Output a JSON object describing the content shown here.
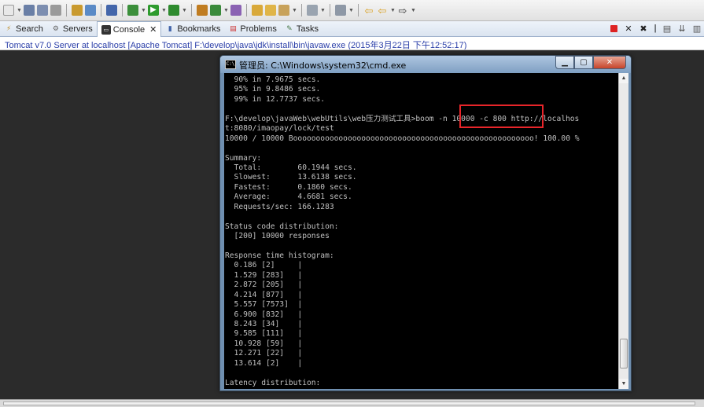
{
  "toolbar": {
    "icons": [
      "new-icon",
      "save-icon",
      "save-all-icon",
      "print-icon",
      "build-icon",
      "debug-skip-icon",
      "skip-breakpoints-icon",
      "ant-icon",
      "run-icon",
      "run-external-icon",
      "new-package-icon",
      "refresh-icon",
      "open-type-icon",
      "open-folder-icon",
      "edit-icon",
      "next-annotation-icon",
      "prev-annotation-icon",
      "back-icon",
      "forward-icon"
    ]
  },
  "tabs": [
    {
      "label": "Search",
      "icon": "search-icon"
    },
    {
      "label": "Servers",
      "icon": "servers-icon"
    },
    {
      "label": "Console",
      "icon": "console-icon",
      "active": true
    },
    {
      "label": "Bookmarks",
      "icon": "bookmarks-icon"
    },
    {
      "label": "Problems",
      "icon": "problems-icon"
    },
    {
      "label": "Tasks",
      "icon": "tasks-icon"
    }
  ],
  "tab_close": "✕",
  "console_header": "Tomcat v7.0 Server at localhost [Apache Tomcat] F:\\develop\\java\\jdk\\install\\bin\\javaw.exe (2015年3月22日 下午12:52:17)",
  "cmd_window": {
    "title": "管理员: C:\\Windows\\system32\\cmd.exe",
    "icon_text": "C:\\",
    "lines": [
      "  90% in 7.9675 secs.",
      "  95% in 9.8486 secs.",
      "  99% in 12.7737 secs.",
      "",
      "F:\\develop\\javaWeb\\webUtils\\web压力测试工具>boom -n 10000 -c 800 http://localhos",
      "t:8080/imaopay/lock/test",
      "10000 / 10000 Booooooooooooooooooooooooooooooooooooooooooooooooooooo! 100.00 %",
      "",
      "Summary:",
      "  Total:        60.1944 secs.",
      "  Slowest:      13.6138 secs.",
      "  Fastest:      0.1860 secs.",
      "  Average:      4.6681 secs.",
      "  Requests/sec: 166.1283",
      "",
      "Status code distribution:",
      "  [200] 10000 responses",
      "",
      "Response time histogram:",
      "  0.186 [2]     |",
      "  1.529 [283]   |",
      "  2.872 [205]   |",
      "  4.214 [877]   |",
      "  5.557 [7573]  |",
      "  6.900 [832]   |",
      "  8.243 [34]    |",
      "  9.585 [111]   |",
      "  10.928 [59]   |",
      "  12.271 [22]   |",
      "  13.614 [2]    |",
      "",
      "Latency distribution:"
    ]
  },
  "colors": {
    "console_link": "#2a3ea8",
    "highlight": "#e8252a",
    "cmd_text": "#c0c0c0",
    "cmd_bg": "#000000"
  }
}
